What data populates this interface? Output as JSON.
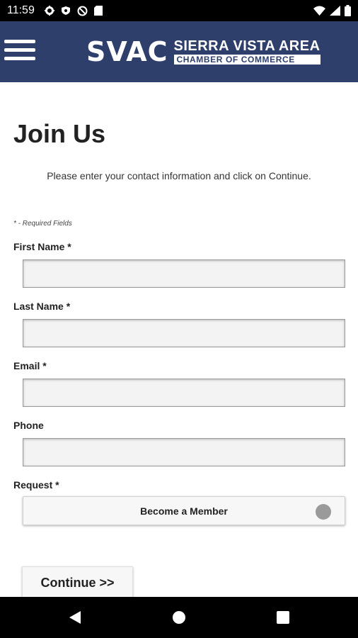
{
  "status_bar": {
    "time": "11:59",
    "left_icons": [
      "gear-icon",
      "shield-icon",
      "no-data-icon",
      "sd-card-icon"
    ],
    "right_icons": [
      "wifi-icon",
      "cell-signal-icon",
      "battery-icon"
    ]
  },
  "header": {
    "logo_main": "SVAC",
    "logo_line1": "SIERRA VISTA AREA",
    "logo_line2": "CHAMBER OF COMMERCE",
    "background_color": "#2f3f6c"
  },
  "page": {
    "title": "Join Us",
    "instructions": "Please enter your contact information and click on Continue.",
    "required_note": "* - Required Fields"
  },
  "form": {
    "first_name": {
      "label": "First Name *",
      "value": ""
    },
    "last_name": {
      "label": "Last Name *",
      "value": ""
    },
    "email": {
      "label": "Email *",
      "value": ""
    },
    "phone": {
      "label": "Phone",
      "value": ""
    },
    "request": {
      "label": "Request *",
      "selected": "Become a Member"
    }
  },
  "buttons": {
    "continue": "Continue >>"
  },
  "nav_bar": {
    "icons": [
      "back-icon",
      "home-icon",
      "recents-icon"
    ]
  }
}
